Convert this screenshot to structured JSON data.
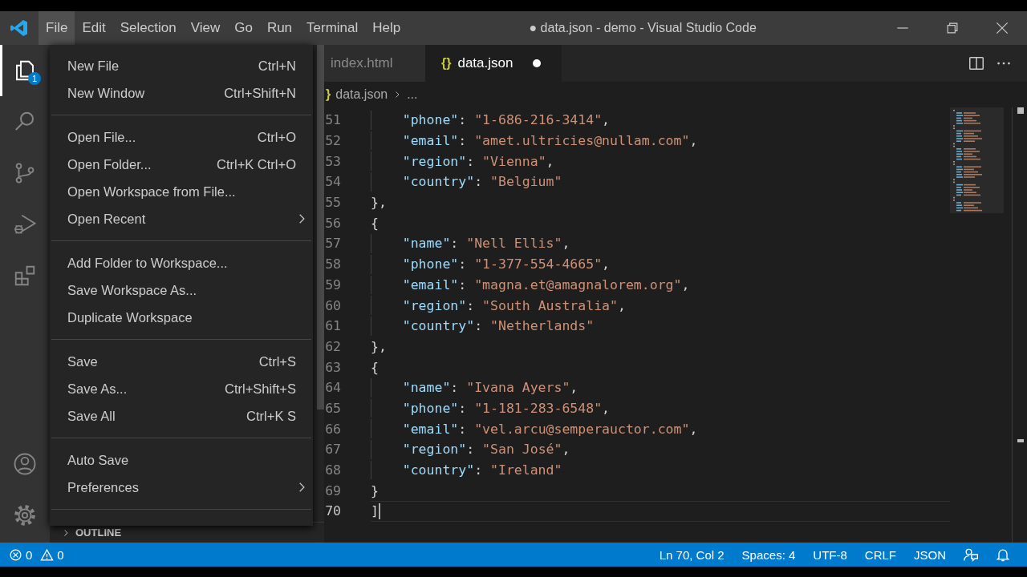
{
  "window": {
    "title": "● data.json - demo - Visual Studio Code"
  },
  "menubar": [
    {
      "label": "File",
      "selected": true
    },
    {
      "label": "Edit",
      "selected": false
    },
    {
      "label": "Selection",
      "selected": false
    },
    {
      "label": "View",
      "selected": false
    },
    {
      "label": "Go",
      "selected": false
    },
    {
      "label": "Run",
      "selected": false
    },
    {
      "label": "Terminal",
      "selected": false
    },
    {
      "label": "Help",
      "selected": false
    }
  ],
  "activity_bar": [
    {
      "kind": "explorer",
      "selected": true,
      "badge": "1"
    },
    {
      "kind": "search",
      "selected": false
    },
    {
      "kind": "source-control",
      "selected": false
    },
    {
      "kind": "run",
      "selected": false
    },
    {
      "kind": "extensions",
      "selected": false
    },
    {
      "kind": "account",
      "selected": false
    },
    {
      "kind": "settings",
      "selected": false
    }
  ],
  "file_menu": [
    {
      "kind": "item",
      "label": "New File",
      "shortcut": "Ctrl+N"
    },
    {
      "kind": "item",
      "label": "New Window",
      "shortcut": "Ctrl+Shift+N"
    },
    {
      "kind": "separator"
    },
    {
      "kind": "item",
      "label": "Open File...",
      "shortcut": "Ctrl+O"
    },
    {
      "kind": "item",
      "label": "Open Folder...",
      "shortcut": "Ctrl+K Ctrl+O"
    },
    {
      "kind": "item",
      "label": "Open Workspace from File..."
    },
    {
      "kind": "submenu",
      "label": "Open Recent"
    },
    {
      "kind": "separator"
    },
    {
      "kind": "item",
      "label": "Add Folder to Workspace..."
    },
    {
      "kind": "item",
      "label": "Save Workspace As..."
    },
    {
      "kind": "item",
      "label": "Duplicate Workspace"
    },
    {
      "kind": "separator"
    },
    {
      "kind": "item",
      "label": "Save",
      "shortcut": "Ctrl+S"
    },
    {
      "kind": "item",
      "label": "Save As...",
      "shortcut": "Ctrl+Shift+S"
    },
    {
      "kind": "item",
      "label": "Save All",
      "shortcut": "Ctrl+K S"
    },
    {
      "kind": "separator"
    },
    {
      "kind": "item",
      "label": "Auto Save"
    },
    {
      "kind": "submenu",
      "label": "Preferences"
    },
    {
      "kind": "separator"
    }
  ],
  "sidebar": {
    "sections": [
      {
        "title": "OUTLINE",
        "expanded": false
      }
    ]
  },
  "tabs": [
    {
      "label": "index.html",
      "selected": false,
      "modified": false
    },
    {
      "icon_text": "{}",
      "label": "data.json",
      "selected": true,
      "modified": true
    }
  ],
  "breadcrumb": [
    {
      "icon_text": "}",
      "label": "data.json"
    },
    {
      "label": "..."
    }
  ],
  "editor": {
    "lines": [
      {
        "number": "51",
        "indented": true,
        "current": false,
        "tokens": [
          {
            "kind": "key",
            "text": "\"phone\""
          },
          {
            "kind": "punct",
            "text": ": "
          },
          {
            "kind": "string",
            "text": "\"1-686-216-3414\""
          },
          {
            "kind": "punct",
            "text": ","
          }
        ]
      },
      {
        "number": "52",
        "indented": true,
        "current": false,
        "tokens": [
          {
            "kind": "key",
            "text": "\"email\""
          },
          {
            "kind": "punct",
            "text": ": "
          },
          {
            "kind": "string",
            "text": "\"amet.ultricies@nullam.com\""
          },
          {
            "kind": "punct",
            "text": ","
          }
        ]
      },
      {
        "number": "53",
        "indented": true,
        "current": false,
        "tokens": [
          {
            "kind": "key",
            "text": "\"region\""
          },
          {
            "kind": "punct",
            "text": ": "
          },
          {
            "kind": "string",
            "text": "\"Vienna\""
          },
          {
            "kind": "punct",
            "text": ","
          }
        ]
      },
      {
        "number": "54",
        "indented": true,
        "current": false,
        "tokens": [
          {
            "kind": "key",
            "text": "\"country\""
          },
          {
            "kind": "punct",
            "text": ": "
          },
          {
            "kind": "string",
            "text": "\"Belgium\""
          }
        ]
      },
      {
        "number": "55",
        "indented": false,
        "current": false,
        "tokens": [
          {
            "kind": "punct",
            "text": "},"
          }
        ]
      },
      {
        "number": "56",
        "indented": false,
        "current": false,
        "tokens": [
          {
            "kind": "punct",
            "text": "{"
          }
        ]
      },
      {
        "number": "57",
        "indented": true,
        "current": false,
        "tokens": [
          {
            "kind": "key",
            "text": "\"name\""
          },
          {
            "kind": "punct",
            "text": ": "
          },
          {
            "kind": "string",
            "text": "\"Nell Ellis\""
          },
          {
            "kind": "punct",
            "text": ","
          }
        ]
      },
      {
        "number": "58",
        "indented": true,
        "current": false,
        "tokens": [
          {
            "kind": "key",
            "text": "\"phone\""
          },
          {
            "kind": "punct",
            "text": ": "
          },
          {
            "kind": "string",
            "text": "\"1-377-554-4665\""
          },
          {
            "kind": "punct",
            "text": ","
          }
        ]
      },
      {
        "number": "59",
        "indented": true,
        "current": false,
        "tokens": [
          {
            "kind": "key",
            "text": "\"email\""
          },
          {
            "kind": "punct",
            "text": ": "
          },
          {
            "kind": "string",
            "text": "\"magna.et@amagnalorem.org\""
          },
          {
            "kind": "punct",
            "text": ","
          }
        ]
      },
      {
        "number": "60",
        "indented": true,
        "current": false,
        "tokens": [
          {
            "kind": "key",
            "text": "\"region\""
          },
          {
            "kind": "punct",
            "text": ": "
          },
          {
            "kind": "string",
            "text": "\"South Australia\""
          },
          {
            "kind": "punct",
            "text": ","
          }
        ]
      },
      {
        "number": "61",
        "indented": true,
        "current": false,
        "tokens": [
          {
            "kind": "key",
            "text": "\"country\""
          },
          {
            "kind": "punct",
            "text": ": "
          },
          {
            "kind": "string",
            "text": "\"Netherlands\""
          }
        ]
      },
      {
        "number": "62",
        "indented": false,
        "current": false,
        "tokens": [
          {
            "kind": "punct",
            "text": "},"
          }
        ]
      },
      {
        "number": "63",
        "indented": false,
        "current": false,
        "tokens": [
          {
            "kind": "punct",
            "text": "{"
          }
        ]
      },
      {
        "number": "64",
        "indented": true,
        "current": false,
        "tokens": [
          {
            "kind": "key",
            "text": "\"name\""
          },
          {
            "kind": "punct",
            "text": ": "
          },
          {
            "kind": "string",
            "text": "\"Ivana Ayers\""
          },
          {
            "kind": "punct",
            "text": ","
          }
        ]
      },
      {
        "number": "65",
        "indented": true,
        "current": false,
        "tokens": [
          {
            "kind": "key",
            "text": "\"phone\""
          },
          {
            "kind": "punct",
            "text": ": "
          },
          {
            "kind": "string",
            "text": "\"1-181-283-6548\""
          },
          {
            "kind": "punct",
            "text": ","
          }
        ]
      },
      {
        "number": "66",
        "indented": true,
        "current": false,
        "tokens": [
          {
            "kind": "key",
            "text": "\"email\""
          },
          {
            "kind": "punct",
            "text": ": "
          },
          {
            "kind": "string",
            "text": "\"vel.arcu@semperauctor.com\""
          },
          {
            "kind": "punct",
            "text": ","
          }
        ]
      },
      {
        "number": "67",
        "indented": true,
        "current": false,
        "tokens": [
          {
            "kind": "key",
            "text": "\"region\""
          },
          {
            "kind": "punct",
            "text": ": "
          },
          {
            "kind": "string",
            "text": "\"San José\""
          },
          {
            "kind": "punct",
            "text": ","
          }
        ]
      },
      {
        "number": "68",
        "indented": true,
        "current": false,
        "tokens": [
          {
            "kind": "key",
            "text": "\"country\""
          },
          {
            "kind": "punct",
            "text": ": "
          },
          {
            "kind": "string",
            "text": "\"Ireland\""
          }
        ]
      },
      {
        "number": "69",
        "indented": false,
        "current": false,
        "tokens": [
          {
            "kind": "punct",
            "text": "}"
          }
        ]
      },
      {
        "number": "70",
        "indented": false,
        "current": true,
        "tokens": [
          {
            "kind": "punct",
            "text": "]"
          }
        ]
      }
    ]
  },
  "status_bar": {
    "errors": "0",
    "warnings": "0",
    "items": [
      "Ln 70, Col 2",
      "Spaces: 4",
      "UTF-8",
      "CRLF",
      "JSON"
    ]
  }
}
